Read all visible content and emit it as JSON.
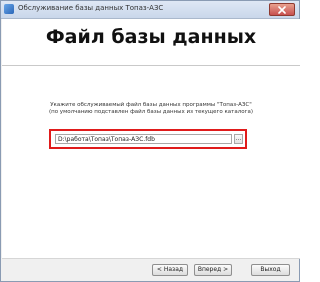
{
  "window": {
    "title": "Обслуживание базы данных Топаз-АЗС"
  },
  "header": {
    "title": "Файл базы данных"
  },
  "content": {
    "description_line1": "Укажите обслуживаемый файл базы данных программы \"Топаз-АЗС\"",
    "description_line2": "(по умолчанию подставлен файл базы данных из текущего каталога)",
    "path_value": "D:\\работа\\Топаз\\Топаз-АЗС.fdb",
    "browse_label": "..."
  },
  "buttons": {
    "back": "< Назад",
    "next": "Вперед >",
    "exit": "Выход"
  },
  "icons": {
    "app": "app-icon",
    "close": "close-icon"
  }
}
